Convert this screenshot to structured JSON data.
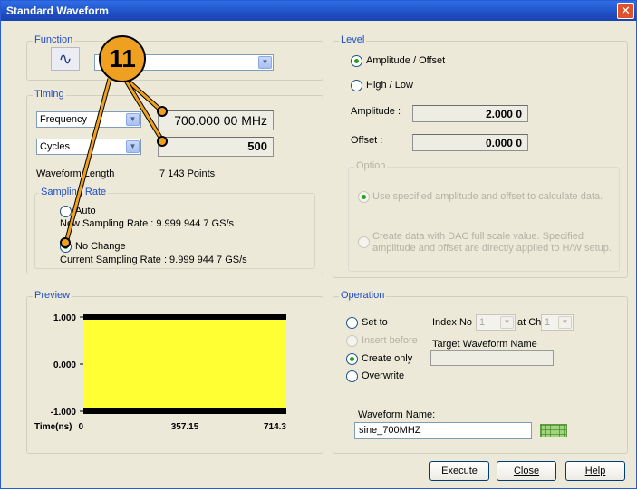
{
  "window": {
    "title": "Standard Waveform",
    "close_glyph": "✕"
  },
  "callout": {
    "number": "11"
  },
  "function": {
    "label": "Function",
    "icon": "sine-wave-icon",
    "icon_glyph": "∿",
    "selected": ""
  },
  "timing": {
    "label": "Timing",
    "param_select": "Frequency",
    "param_value": "700.000 00 MHz",
    "count_select": "Cycles",
    "count_value": "500",
    "waveform_length_label": "Waveform Length",
    "waveform_length_value": "7 143 Points"
  },
  "sampling": {
    "label": "Sampling Rate",
    "auto_label": "Auto",
    "new_rate_text": "New Sampling Rate : 9.999 944 7 GS/s",
    "no_change_label": "No Change",
    "current_rate_text": "Current Sampling Rate : 9.999 944 7 GS/s",
    "selected": "No Change"
  },
  "level": {
    "label": "Level",
    "amp_offset_label": "Amplitude / Offset",
    "high_low_label": "High / Low",
    "selected": "Amplitude / Offset",
    "amplitude_label": "Amplitude :",
    "amplitude_value": "2.000 0",
    "offset_label": "Offset :",
    "offset_value": "0.000 0",
    "option_label": "Option",
    "option1_text": "Use specified amplitude and offset to calculate data.",
    "option2_line1": "Create data with DAC full scale value. Specified",
    "option2_line2": "amplitude and offset are directly applied to H/W setup."
  },
  "preview": {
    "label": "Preview",
    "fill_color": "#ffff33"
  },
  "chart_data": {
    "type": "area",
    "title": "",
    "xlabel": "Time(ns)",
    "ylabel": "",
    "x_ticks": [
      "0",
      "357.15",
      "714.3"
    ],
    "y_ticks": [
      "1.000",
      "0.000",
      "-1.000"
    ],
    "xlim": [
      0,
      714.3
    ],
    "ylim": [
      -1.0,
      1.0
    ],
    "series": [
      {
        "x": [
          0,
          714.3
        ],
        "upper": [
          1.0,
          1.0
        ],
        "lower": [
          -1.0,
          -1.0
        ]
      }
    ]
  },
  "operation": {
    "label": "Operation",
    "set_to_label": "Set to",
    "insert_before_label": "Insert before",
    "create_only_label": "Create only",
    "overwrite_label": "Overwrite",
    "selected": "Create only",
    "index_label": "Index No",
    "index_value": "1",
    "at_ch_label": "at Ch",
    "ch_value": "1",
    "target_label": "Target Waveform Name",
    "target_value": "",
    "waveform_name_label": "Waveform Name:",
    "waveform_name_value": "sine_700MHZ",
    "keyboard_icon": "keyboard-icon"
  },
  "buttons": {
    "execute": "Execute",
    "close": "Close",
    "help": "Help"
  }
}
